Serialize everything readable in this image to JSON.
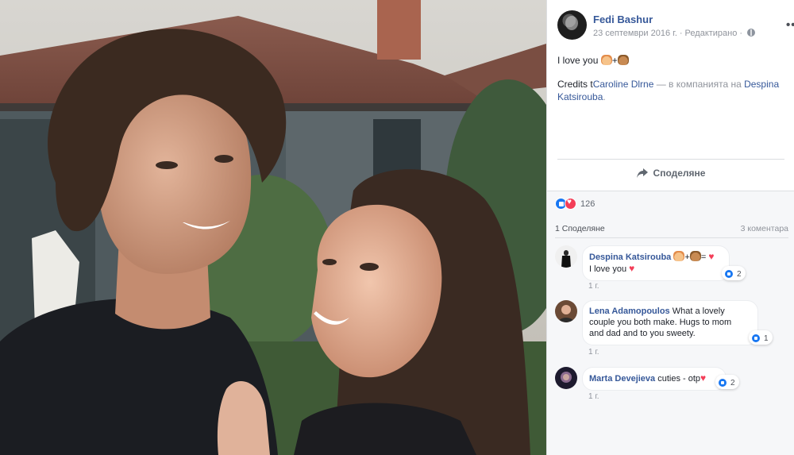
{
  "post": {
    "author": "Fedi Bashur",
    "date": "23 септември 2016 г.",
    "separator": "·",
    "edited": "Редактирано",
    "more_label": "•••",
    "line1": "I love you",
    "plus": "+",
    "credits_prefix": "Credits t",
    "credits_name": "Caroline Dlrne",
    "credits_mid": " — в компанията на ",
    "credits_tag": "Despina Katsirouba",
    "credits_end": "."
  },
  "actions": {
    "share_label": "Споделяне"
  },
  "stats": {
    "reaction_count": "126",
    "shares": "1 Споделяне",
    "comments": "3 коментара"
  },
  "comments": [
    {
      "name": "Despina Katsirouba",
      "text_after_emoji": "=",
      "line2": "I love you",
      "reactions": "2",
      "time": "1 г."
    },
    {
      "name": "Lena Adamopoulos",
      "text": "What a lovely",
      "line2": "couple you both make. Hugs to mom",
      "line3": "and dad and to you sweety.",
      "reactions": "1",
      "time": "1 г."
    },
    {
      "name": "Marta Devejieva",
      "text": "cuties - otp",
      "reactions": "2",
      "time": "1 г."
    }
  ],
  "colors": {
    "link": "#365899",
    "muted": "#90949c",
    "like_blue": "#1877f2",
    "love_red": "#f33e58",
    "panel_bg": "#f6f7f9"
  },
  "icons": [
    "more-options-icon",
    "globe-icon",
    "share-icon",
    "like-reaction-icon",
    "love-reaction-icon",
    "cat-emoji-icon",
    "bear-emoji-icon",
    "heart-emoji-icon"
  ]
}
